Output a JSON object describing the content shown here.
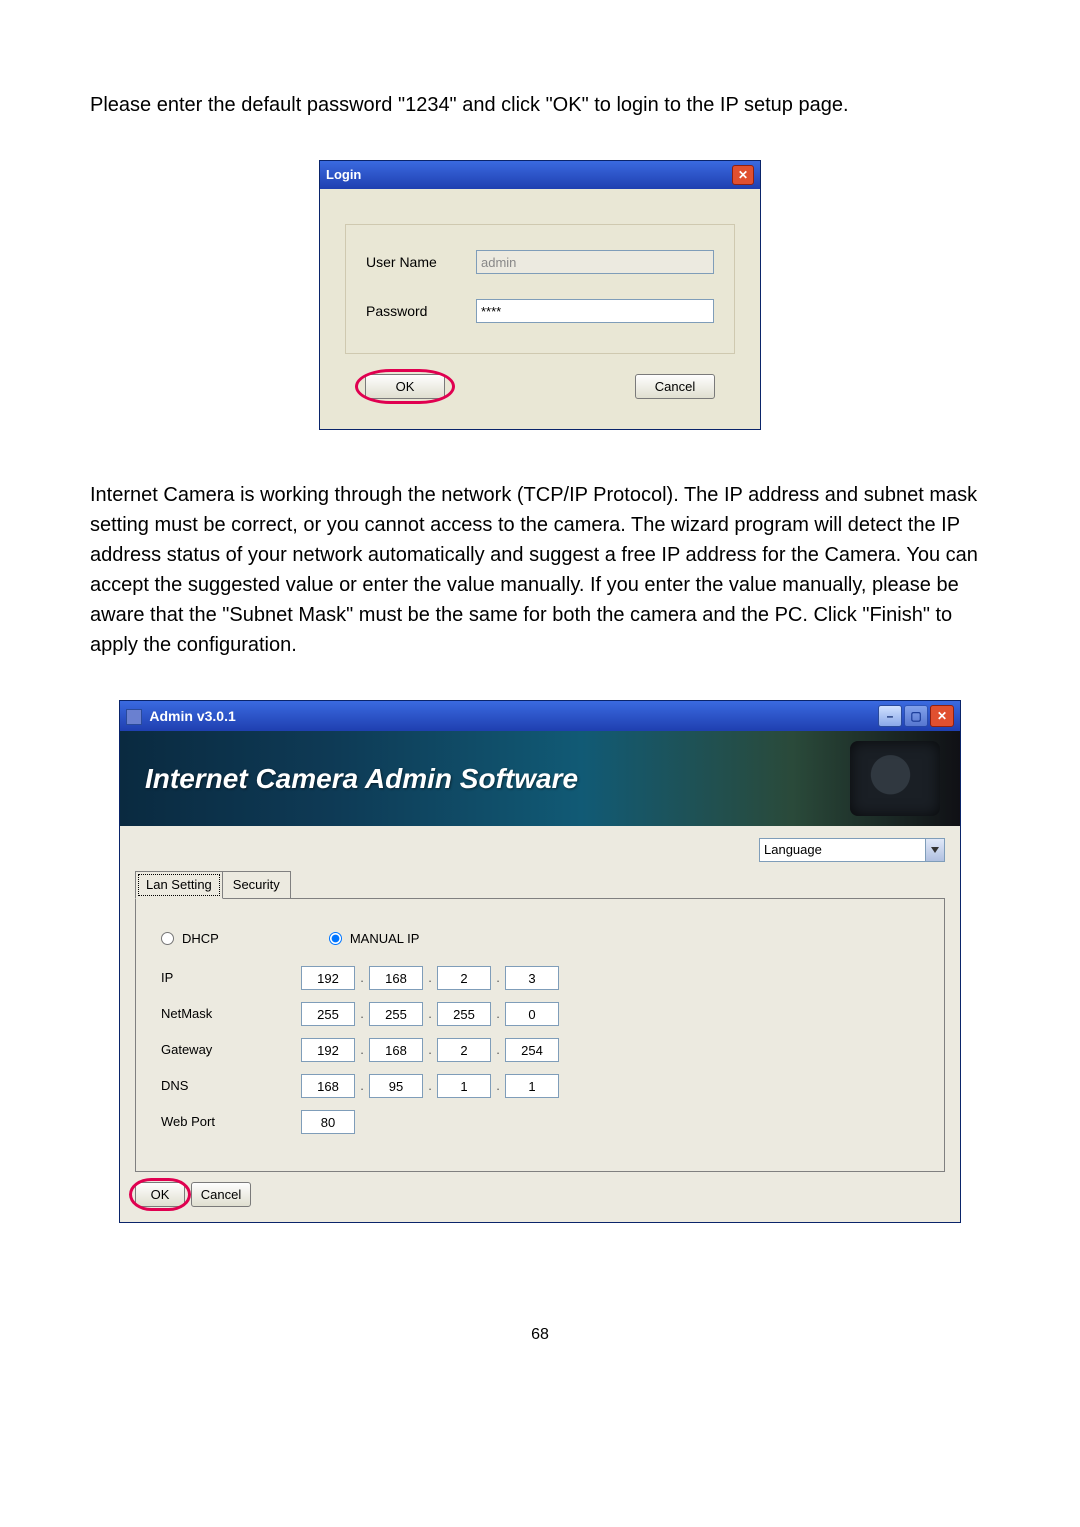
{
  "para1": "Please enter the default password \"1234\" and click \"OK\" to login to the IP setup page.",
  "login": {
    "title": "Login",
    "user_label": "User Name",
    "user_value": "admin",
    "pass_label": "Password",
    "pass_value": "****",
    "ok": "OK",
    "cancel": "Cancel"
  },
  "para2": "Internet Camera is working through the network (TCP/IP Protocol). The IP address and subnet mask setting must be correct, or you cannot access to the camera. The wizard program will detect the IP address status of your network automatically and suggest a free IP address for the Camera. You can accept the suggested value or enter the value manually. If you enter the value manually, please be aware that the \"Subnet Mask\" must be the same for both the camera and the PC. Click \"Finish\" to apply the configuration.",
  "admin": {
    "title": "Admin v3.0.1",
    "banner": "Internet Camera Admin Software",
    "language": "Language",
    "tabs": {
      "lan": "Lan Setting",
      "security": "Security"
    },
    "radios": {
      "dhcp": "DHCP",
      "manual": "MANUAL IP"
    },
    "labels": {
      "ip": "IP",
      "netmask": "NetMask",
      "gateway": "Gateway",
      "dns": "DNS",
      "webport": "Web Port"
    },
    "ip": [
      "192",
      "168",
      "2",
      "3"
    ],
    "netmask": [
      "255",
      "255",
      "255",
      "0"
    ],
    "gateway": [
      "192",
      "168",
      "2",
      "254"
    ],
    "dns": [
      "168",
      "95",
      "1",
      "1"
    ],
    "webport": "80",
    "ok": "OK",
    "cancel": "Cancel"
  },
  "page_number": "68"
}
